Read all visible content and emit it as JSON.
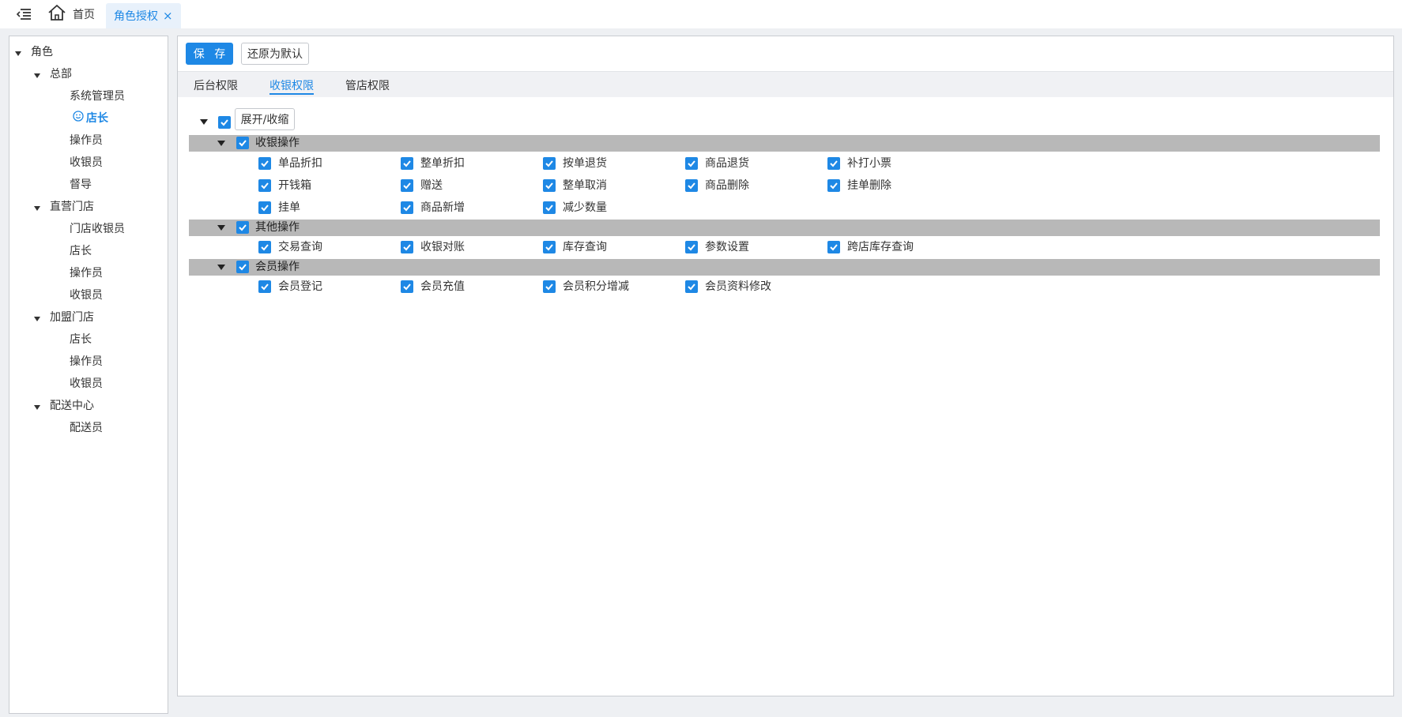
{
  "topbar": {
    "home_label": "首页",
    "active_tab_label": "角色授权",
    "close_glyph": "×"
  },
  "sidebar": {
    "root": "角色",
    "groups": [
      {
        "label": "总部",
        "roles": [
          "系统管理员",
          "店长",
          "操作员",
          "收银员",
          "督导"
        ]
      },
      {
        "label": "直营门店",
        "roles": [
          "门店收银员",
          "店长",
          "操作员",
          "收银员"
        ]
      },
      {
        "label": "加盟门店",
        "roles": [
          "店长",
          "操作员",
          "收银员"
        ]
      },
      {
        "label": "配送中心",
        "roles": [
          "配送员"
        ]
      }
    ],
    "selected_role": "店长"
  },
  "toolbar": {
    "save_label": "保 存",
    "reset_label": "还原为默认"
  },
  "tabs": [
    "后台权限",
    "收银权限",
    "管店权限"
  ],
  "active_tab": "收银权限",
  "tree": {
    "expand_label": "展开/收缩",
    "groups": [
      {
        "label": "收银操作",
        "items": [
          "单品折扣",
          "整单折扣",
          "按单退货",
          "商品退货",
          "补打小票",
          "开钱箱",
          "赠送",
          "整单取消",
          "商品删除",
          "挂单删除",
          "挂单",
          "商品新增",
          "减少数量"
        ]
      },
      {
        "label": "其他操作",
        "items": [
          "交易查询",
          "收银对账",
          "库存查询",
          "参数设置",
          "跨店库存查询"
        ]
      },
      {
        "label": "会员操作",
        "items": [
          "会员登记",
          "会员充值",
          "会员积分增减",
          "会员资料修改"
        ]
      }
    ]
  },
  "colors": {
    "accent": "#1e88e5",
    "group_bar": "#b8b8b8",
    "page_bg": "#eef0f3"
  },
  "icons": {
    "menu_toggle": "menu-collapse-icon",
    "home": "home-icon",
    "selected_role": "smile-icon",
    "checkbox": "checkbox-checked-icon"
  }
}
